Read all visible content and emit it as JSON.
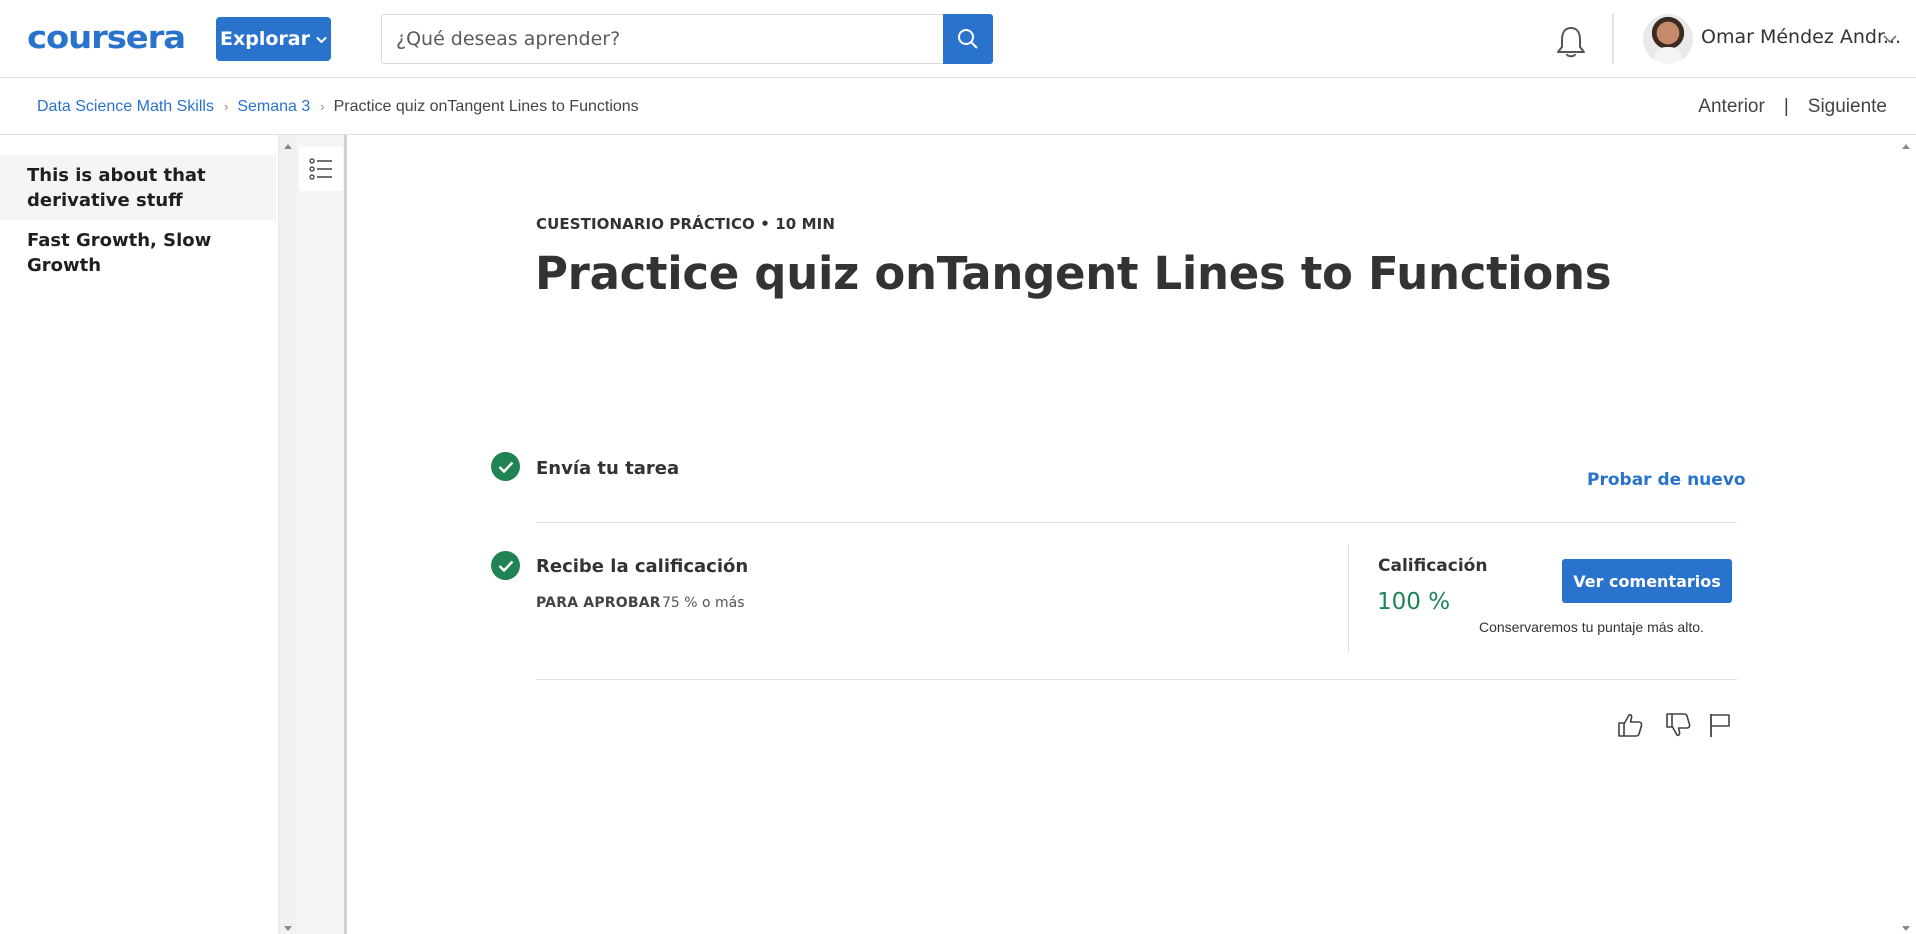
{
  "header": {
    "logo_text": "coursera",
    "explore_label": "Explorar",
    "search_placeholder": "¿Qué deseas aprender?",
    "user_name": "Omar Méndez Andr..."
  },
  "breadcrumb": {
    "items": [
      "Data Science Math Skills",
      "Semana 3"
    ],
    "current": "Practice quiz onTangent Lines to Functions",
    "prev_label": "Anterior",
    "divider": "|",
    "next_label": "Siguiente"
  },
  "sidebar": {
    "items": [
      {
        "label": "This is about that derivative stuff",
        "active": true
      },
      {
        "label": "Fast Growth, Slow Growth",
        "active": false
      }
    ]
  },
  "main": {
    "eyebrow": "CUESTIONARIO PRÁCTICO • 10 MIN",
    "title": "Practice quiz onTangent Lines to Functions",
    "step1_title": "Envía tu tarea",
    "retry_label": "Probar de nuevo",
    "step2_title": "Recibe la calificación",
    "pass_label": "PARA APROBAR",
    "pass_value": "75 % o más",
    "grade_label": "Calificación",
    "grade_value": "100 %",
    "feedback_label": "Ver comentarios",
    "keep_note": "Conservaremos tu puntaje más alto."
  },
  "colors": {
    "brand_blue": "#2a73cc",
    "success_green": "#1f8354"
  }
}
